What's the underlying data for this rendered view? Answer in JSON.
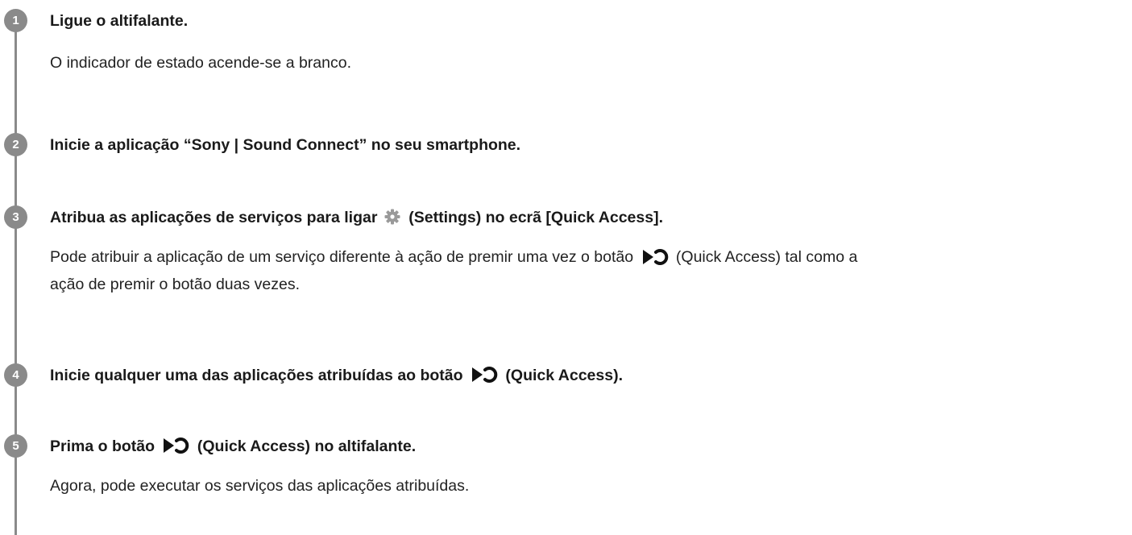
{
  "steps": [
    {
      "number": "1",
      "title": "Ligue o altifalante.",
      "body": "O indicador de estado acende-se a branco."
    },
    {
      "number": "2",
      "title": "Inicie a aplicação “Sony | Sound Connect” no seu smartphone."
    },
    {
      "number": "3",
      "title_before_icon": "Atribua as aplicações de serviços para ligar",
      "title_after_icon": "(Settings) no ecrã [Quick Access].",
      "body_before_icon": "Pode atribuir a aplicação de um serviço diferente à ação de premir uma vez o botão",
      "body_after_icon": "(Quick Access) tal como a",
      "body_line2": "ação de premir o botão duas vezes."
    },
    {
      "number": "4",
      "title_before_icon": "Inicie qualquer uma das aplicações atribuídas ao botão",
      "title_after_icon": "(Quick Access)."
    },
    {
      "number": "5",
      "title_before_icon": "Prima o botão",
      "title_after_icon": "(Quick Access) no altifalante.",
      "body": "Agora, pode executar os serviços das aplicações atribuídas."
    }
  ],
  "icons": {
    "settings": "gear-icon",
    "quick_access": "quick-access-icon"
  },
  "colors": {
    "badge": "#8a8a8a",
    "text": "#1a1a1a"
  }
}
